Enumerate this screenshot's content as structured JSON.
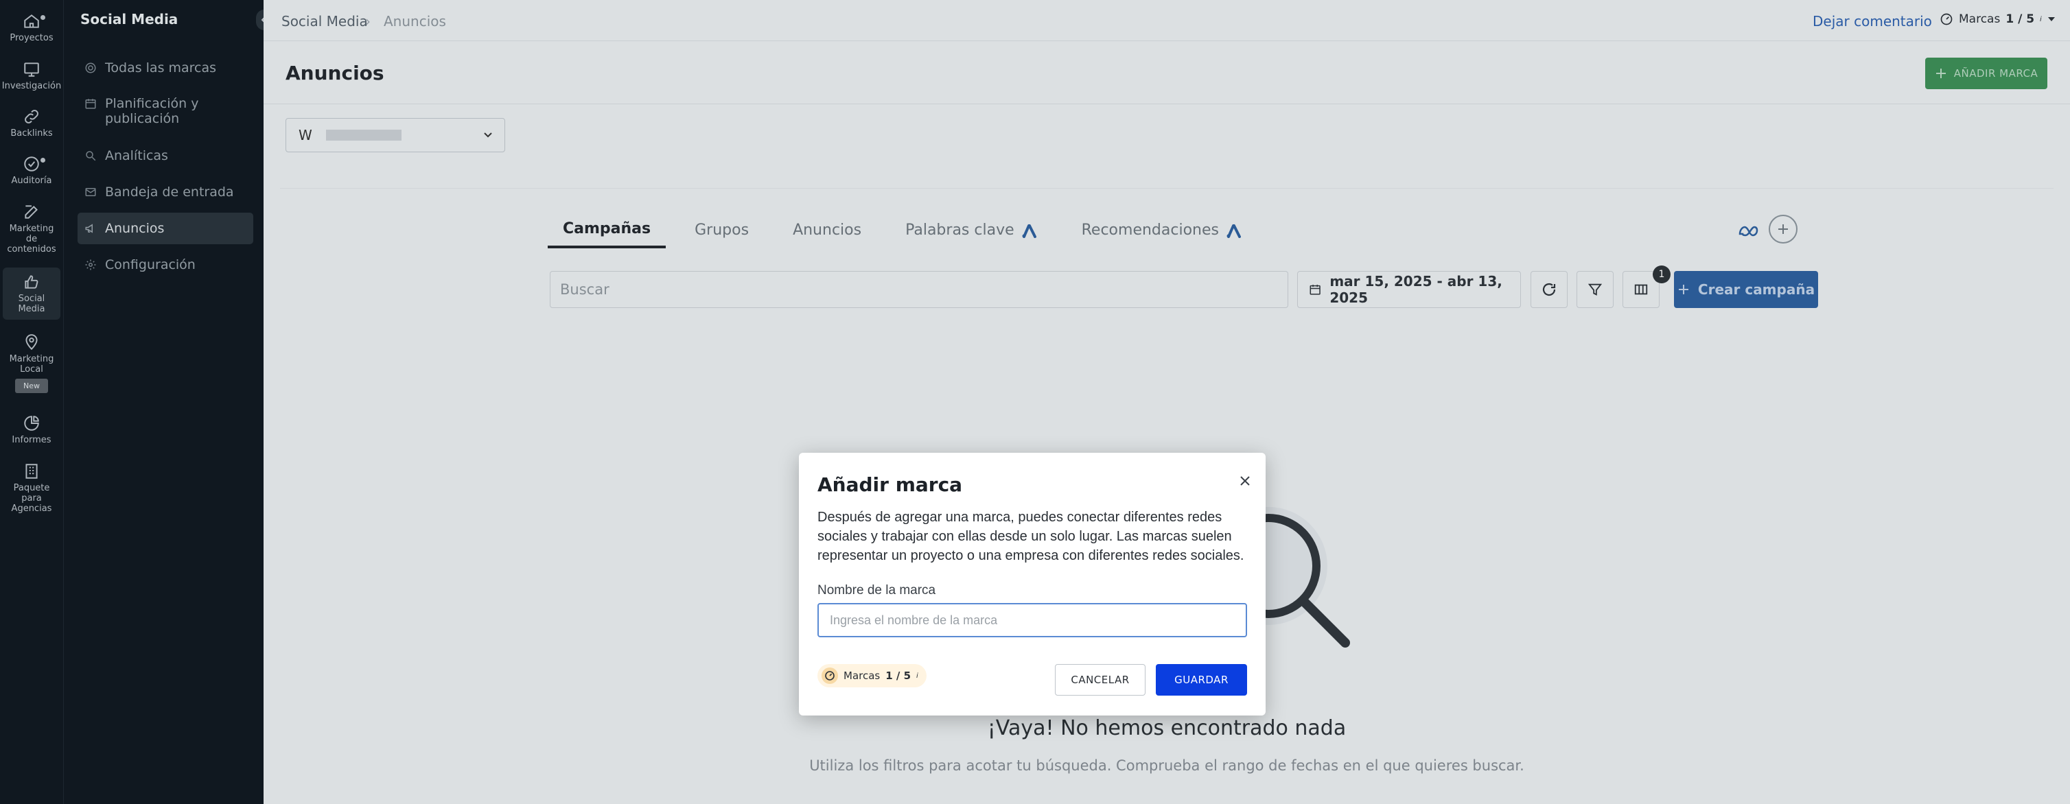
{
  "rail": {
    "items": [
      {
        "label": "Proyectos",
        "icon": "home-icon"
      },
      {
        "label": "Investigación",
        "icon": "monitor-icon"
      },
      {
        "label": "Backlinks",
        "icon": "link-icon"
      },
      {
        "label": "Auditoría",
        "icon": "check-circle-icon"
      },
      {
        "label": "Marketing de contenidos",
        "icon": "edit-icon"
      },
      {
        "label": "Social Media",
        "icon": "thumbs-up-icon"
      },
      {
        "label": "Marketing Local",
        "icon": "map-pin-icon"
      },
      {
        "label": "Informes",
        "icon": "pie-chart-icon"
      },
      {
        "label": "Paquete para Agencias",
        "icon": "building-icon"
      }
    ],
    "new_badge": "New"
  },
  "subnav": {
    "title": "Social Media",
    "items": [
      {
        "label": "Todas las marcas",
        "icon": "target-icon"
      },
      {
        "label": "Planificación y publicación",
        "icon": "calendar-icon"
      },
      {
        "label": "Analíticas",
        "icon": "search-analytics-icon"
      },
      {
        "label": "Bandeja de entrada",
        "icon": "inbox-icon"
      },
      {
        "label": "Anuncios",
        "icon": "megaphone-icon"
      },
      {
        "label": "Configuración",
        "icon": "gear-icon"
      }
    ]
  },
  "topbar": {
    "breadcrumb_root": "Social Media",
    "breadcrumb_sep": "›",
    "breadcrumb_current": "Anuncios",
    "leave_comment": "Dejar comentario",
    "brands_label": "Marcas",
    "brands_count": "1 / 5",
    "brands_info": "i"
  },
  "page": {
    "title": "Anuncios",
    "add_brand_button": "AÑADIR MARCA",
    "brand_select_initial": "W"
  },
  "tabs": [
    {
      "label": "Campañas",
      "active": true
    },
    {
      "label": "Grupos",
      "active": false
    },
    {
      "label": "Anuncios",
      "active": false
    },
    {
      "label": "Palabras clave",
      "active": false
    },
    {
      "label": "Recomendaciones",
      "active": false
    }
  ],
  "toolbar": {
    "search_placeholder": "Buscar",
    "date_range": "mar 15, 2025 - abr 13, 2025",
    "columns_badge": "1",
    "create_campaign": "Crear campaña"
  },
  "empty_state": {
    "title": "¡Vaya! No hemos encontrado nada",
    "subtitle": "Utiliza los filtros para acotar tu búsqueda. Comprueba el rango de fechas en el que quieres buscar."
  },
  "modal": {
    "title": "Añadir marca",
    "description": "Después de agregar una marca, puedes conectar diferentes redes sociales y trabajar con ellas desde un solo lugar. Las marcas suelen representar un proyecto o una empresa con diferentes redes sociales.",
    "field_label": "Nombre de la marca",
    "field_placeholder": "Ingresa el nombre de la marca",
    "field_value": "",
    "brands_label": "Marcas",
    "brands_count": "1 / 5",
    "brands_info": "i",
    "cancel": "CANCELAR",
    "save": "GUARDAR"
  },
  "colors": {
    "primary_button": "#0b3ee0",
    "add_brand_green": "#3d8e57",
    "sidebar_bg": "#101820"
  }
}
